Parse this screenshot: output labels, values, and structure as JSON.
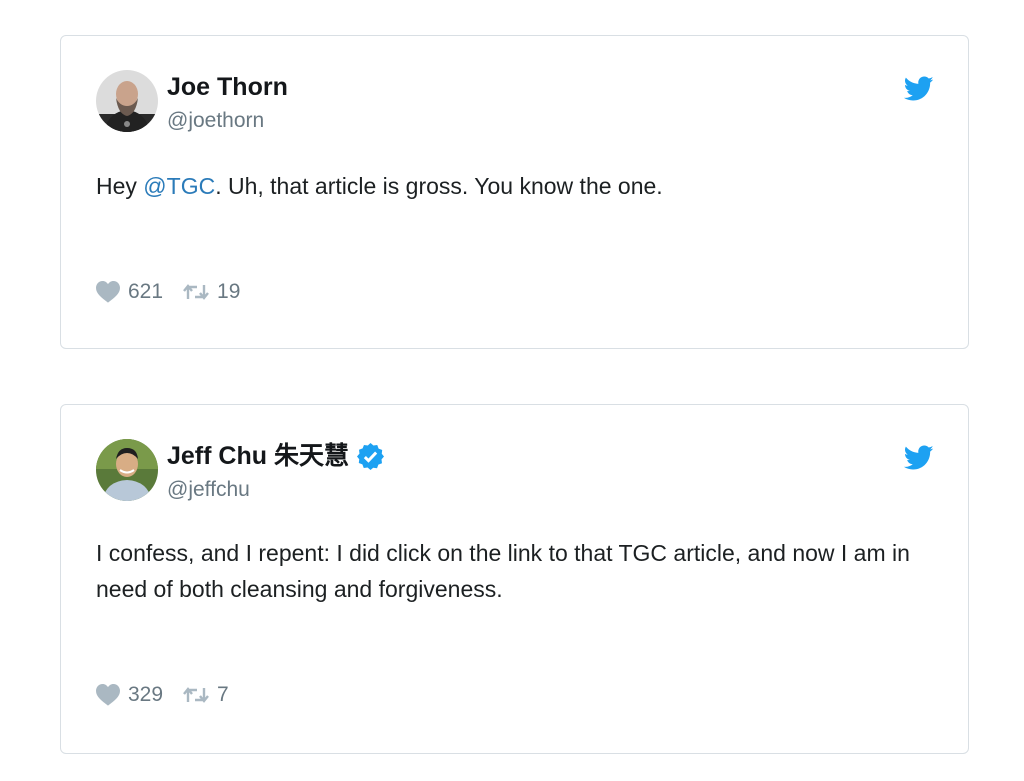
{
  "colors": {
    "twitter_blue": "#1da1f2",
    "link_blue": "#2b7bb9",
    "muted_gray": "#697882",
    "border": "#d9dfe4"
  },
  "tweets": [
    {
      "display_name": "Joe Thorn",
      "handle": "@joethorn",
      "verified": false,
      "text_before": "Hey ",
      "mention": "@TGC",
      "text_after": ". Uh, that article is gross. You know the one.",
      "likes": "621",
      "retweets": "19",
      "icons": [
        "avatar",
        "twitter-bird-icon",
        "heart-icon",
        "retweet-icon"
      ]
    },
    {
      "display_name": "Jeff Chu 朱天慧",
      "handle": "@jeffchu",
      "verified": true,
      "text_before": "I confess, and I repent: I did click on the link to that TGC article, and now I am in need of both cleansing and forgiveness.",
      "likes": "329",
      "retweets": "7",
      "icons": [
        "avatar",
        "verified-badge-icon",
        "twitter-bird-icon",
        "heart-icon",
        "retweet-icon"
      ]
    }
  ]
}
